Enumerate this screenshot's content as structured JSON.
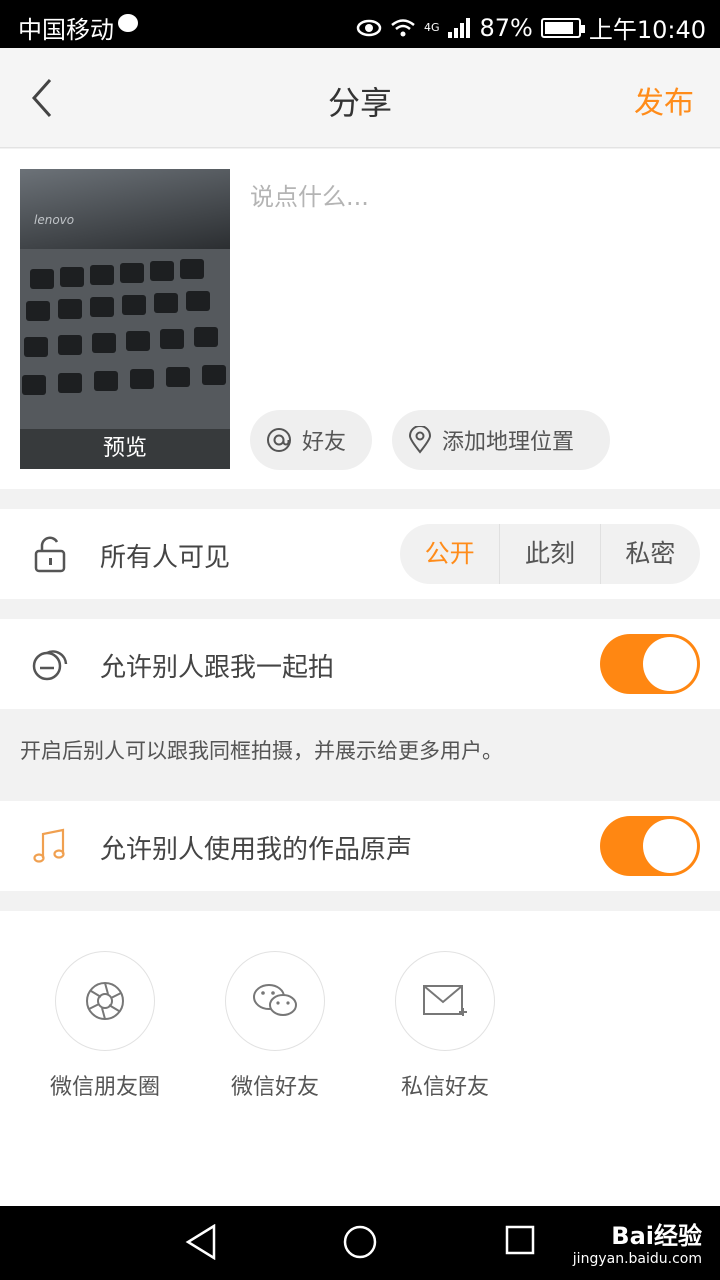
{
  "status_bar": {
    "carrier": "中国移动",
    "network": "4G",
    "battery": "87%",
    "time": "上午10:40"
  },
  "header": {
    "title": "分享",
    "publish_label": "发布"
  },
  "compose": {
    "preview_label": "预览",
    "image_brand_text": "lenovo",
    "text_placeholder": "说点什么...",
    "mention_label": "好友",
    "location_label": "添加地理位置"
  },
  "visibility": {
    "label": "所有人可见",
    "options": [
      "公开",
      "此刻",
      "私密"
    ],
    "selected": "公开"
  },
  "coshoot": {
    "label": "允许别人跟我一起拍",
    "enabled": true,
    "note": "开启后别人可以跟我同框拍摄，并展示给更多用户。"
  },
  "sound": {
    "label": "允许别人使用我的作品原声",
    "enabled": true
  },
  "share_targets": [
    {
      "label": "微信朋友圈",
      "icon": "camera-aperture-icon"
    },
    {
      "label": "微信好友",
      "icon": "wechat-icon"
    },
    {
      "label": "私信好友",
      "icon": "mail-add-icon"
    }
  ],
  "watermark": {
    "brand": "Bai经验",
    "url": "jingyan.baidu.com"
  },
  "colors": {
    "accent": "#ff8c1a",
    "toggle_on": "#ff8712"
  }
}
